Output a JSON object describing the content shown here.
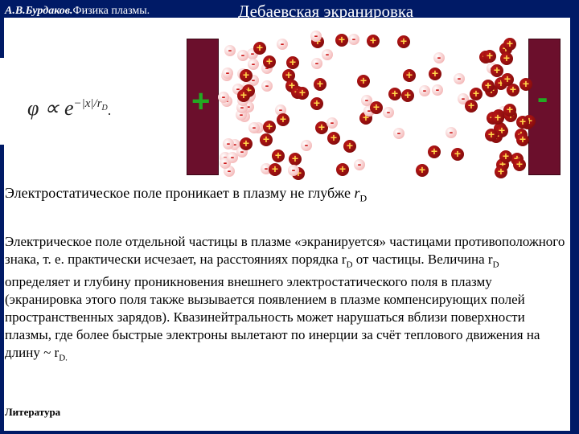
{
  "header": {
    "author": "А.В.Бурдаков.",
    "course": "Физика плазмы.",
    "title": "Дебаевская экранировка"
  },
  "formula": {
    "lhs": "φ ∝ e",
    "exponent": "−|x|/r",
    "exponent_sub": "D",
    "trailing": "."
  },
  "figure": {
    "left_plate_sign": "+",
    "right_plate_sign": "-",
    "colors": {
      "plate": "#6b0f2c",
      "positive": "#c01818",
      "negative": "#cc1818",
      "sign": "#22aa22"
    }
  },
  "caption": {
    "text": "Электростатическое поле проникает в плазму не глубже ",
    "symbol": "r",
    "sub": "D"
  },
  "body": {
    "p1": "Электрическое поле отдельной частицы в плазме «экранируется» частицами противоположного знака, т. е. практически исчезает, на расстояниях порядка r",
    "p1_sub": "D",
    "p2": " от частицы. Величина r",
    "p2_sub": "D",
    "p3": " определяет и глубину проникновения внешнего электростатического поля в плазму (экранировка этого поля также вызывается появлением в плазме компенсирующих полей пространственных зарядов). Квазинейтральность может нарушаться вблизи поверхности плазмы, где более быстрые электроны вылетают по инерции за счёт теплового движения на длину ~ r",
    "p3_sub": "D."
  },
  "footer": {
    "label": "Литература"
  }
}
